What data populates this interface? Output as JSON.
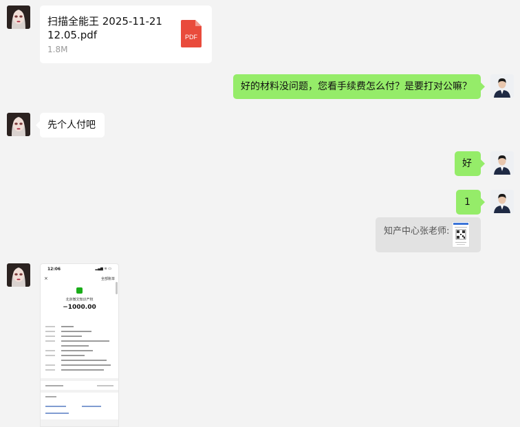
{
  "messages": {
    "file": {
      "name": "扫描全能王 2025-11-21 12.05.pdf",
      "size": "1.8M",
      "icon_label": "PDF"
    },
    "out1": "好的材料没问题，您看手续费怎么付？是要打对公嘛？",
    "in2": "先个人付吧",
    "out2": "好",
    "out3": "1",
    "card": {
      "text": "知产中心张老师:"
    },
    "image": {
      "status_time": "12:06",
      "close": "×",
      "all_bills": "全部账单",
      "merchant": "北京微文知识产权",
      "amount": "−1000.00"
    }
  },
  "colors": {
    "out_bubble": "#95ec69",
    "in_bubble": "#ffffff",
    "background": "#f3f3f3",
    "pdf_red": "#e94b3c"
  }
}
